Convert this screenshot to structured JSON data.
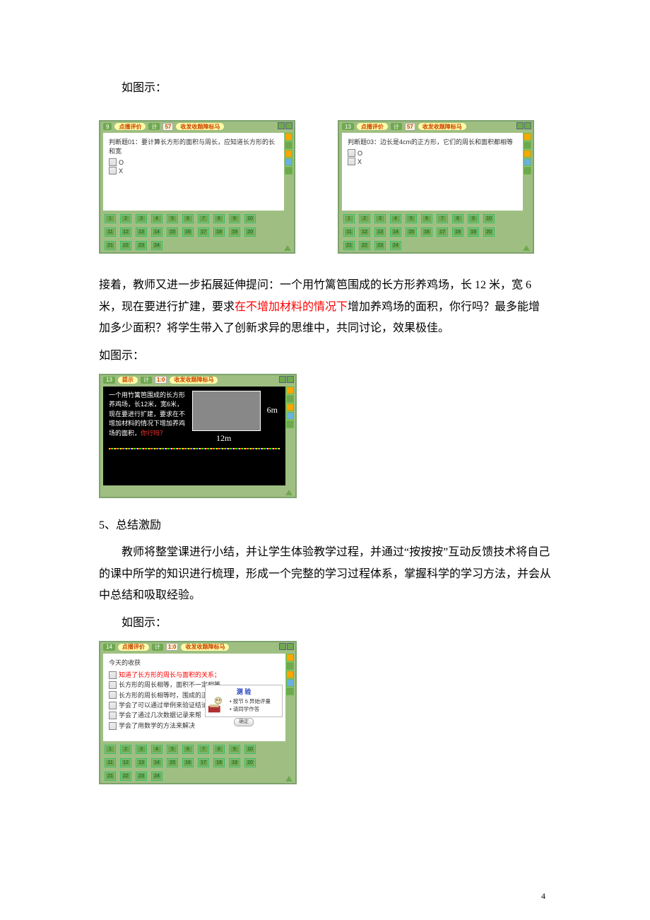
{
  "labels": {
    "as_shown": "如图示：",
    "as_shown_indent": "如图示："
  },
  "text": {
    "para1_a": "接着，教师又进一步拓展延伸提问：一个用竹篱笆围成的长方形养鸡场，长 12 米，宽 6 米，现在要进行扩建，要求",
    "para1_red": "在不增加材料的情况下",
    "para1_b": "增加养鸡场的面积，你行吗？最多能增加多少面积？将学生带入了创新求异的思维中，共同讨论，效果极佳。",
    "section5": "5、总结激励",
    "para2": "教师将整堂课进行小结，并让学生体验教学过程，并通过“按按按”互动反馈技术将自己的课中所学的知识进行梳理，形成一个完整的学习过程体系，掌握科学的学习方法，并会从中总结和吸取经验。"
  },
  "app": {
    "toolbar": {
      "btn_review": "点播评价",
      "timer_tag": "计",
      "timer_value": "1:0",
      "answer_bar": "收发收题障标马",
      "count_badge": "57",
      "page9": "9",
      "page13": "13",
      "page14": "14"
    },
    "q1": {
      "title": "判断题01：要计算长方形的面积与周长，应知道长方形的长和宽",
      "opt_o": "O",
      "opt_x": "X"
    },
    "q2": {
      "title": "判断题03：边长是4cm的正方形，它们的周长和面积都相等",
      "opt_o": "O",
      "opt_x": "X"
    },
    "chicken": {
      "hint_label": "提示",
      "body": "一个用竹篱笆围成的长方形养鸡场，长12米，宽6米，现在要进行扩建，要求在不增加材料的情况下增加养鸡场的面积，",
      "body_red": "你行吗？",
      "dim_w": "12m",
      "dim_h": "6m"
    },
    "summary": {
      "title": "今天的收获",
      "items": [
        "知道了长方形的周长与面积的关系；",
        "长方形的周长相等，面积不一定相等",
        "长方形的周长相等时，围成的正方形的面积是最大的",
        "学会了可以通过举例来验证结论",
        "学会了通过几次数据记录来帮",
        "学会了用数学的方法来解决"
      ],
      "test_title": "测 验",
      "test_line1": "按节 5 异始评量",
      "test_line2": "请同学作答",
      "ok": "确定"
    },
    "numbers_row1": [
      "1",
      "2",
      "3",
      "4",
      "5",
      "6",
      "7",
      "8",
      "9",
      "10"
    ],
    "numbers_row2": [
      "11",
      "12",
      "13",
      "14",
      "15",
      "16",
      "17",
      "18",
      "19",
      "20"
    ],
    "numbers_row3": [
      "21",
      "22",
      "23",
      "24"
    ]
  },
  "footer": {
    "page": "4"
  }
}
